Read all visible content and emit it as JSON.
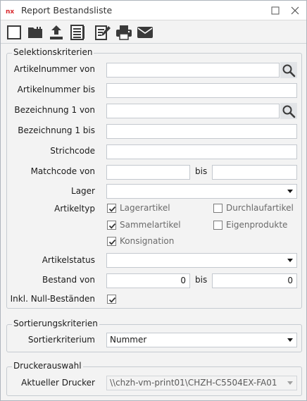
{
  "window": {
    "title": "Report Bestandsliste",
    "app_icon": "nx-logo-icon"
  },
  "toolbar": {
    "buttons": [
      {
        "name": "new-icon"
      },
      {
        "name": "open-folder-icon"
      },
      {
        "name": "upload-icon"
      },
      {
        "name": "list-icon"
      },
      {
        "name": "edit-icon"
      },
      {
        "name": "print-icon"
      },
      {
        "name": "mail-icon"
      }
    ]
  },
  "selection": {
    "title": "Selektionskriterien",
    "artikelnummer_von": {
      "label": "Artikelnummer von",
      "value": ""
    },
    "artikelnummer_bis": {
      "label": "Artikelnummer bis",
      "value": ""
    },
    "bezeichnung_von": {
      "label": "Bezeichnung 1 von",
      "value": ""
    },
    "bezeichnung_bis": {
      "label": "Bezeichnung 1 bis",
      "value": ""
    },
    "strichcode": {
      "label": "Strichcode",
      "value": ""
    },
    "matchcode": {
      "label": "Matchcode von",
      "value_from": "",
      "bis_label": "bis",
      "value_to": ""
    },
    "lager": {
      "label": "Lager",
      "value": ""
    },
    "artikeltyp": {
      "label": "Artikeltyp",
      "options": [
        {
          "label": "Lagerartikel",
          "checked": true
        },
        {
          "label": "Durchlaufartikel",
          "checked": false
        },
        {
          "label": "Sammelartikel",
          "checked": true
        },
        {
          "label": "Eigenprodukte",
          "checked": false
        },
        {
          "label": "Konsignation",
          "checked": true
        }
      ]
    },
    "artikelstatus": {
      "label": "Artikelstatus",
      "value": ""
    },
    "bestand": {
      "label": "Bestand von",
      "value_from": "0",
      "bis_label": "bis",
      "value_to": "0"
    },
    "inkl_null": {
      "label": "Inkl. Null-Beständen",
      "checked": true
    }
  },
  "sorting": {
    "title": "Sortierungskriterien",
    "label": "Sortierkriterium",
    "value": "Nummer"
  },
  "printer": {
    "title": "Druckerauswahl",
    "label": "Aktueller Drucker",
    "value": "\\\\chzh-vm-print01\\CHZH-C5504EX-FA01"
  },
  "colors": {
    "accent": "#2d6fb7",
    "checkmark": "#333333",
    "app_icon_red": "#d8262b"
  }
}
